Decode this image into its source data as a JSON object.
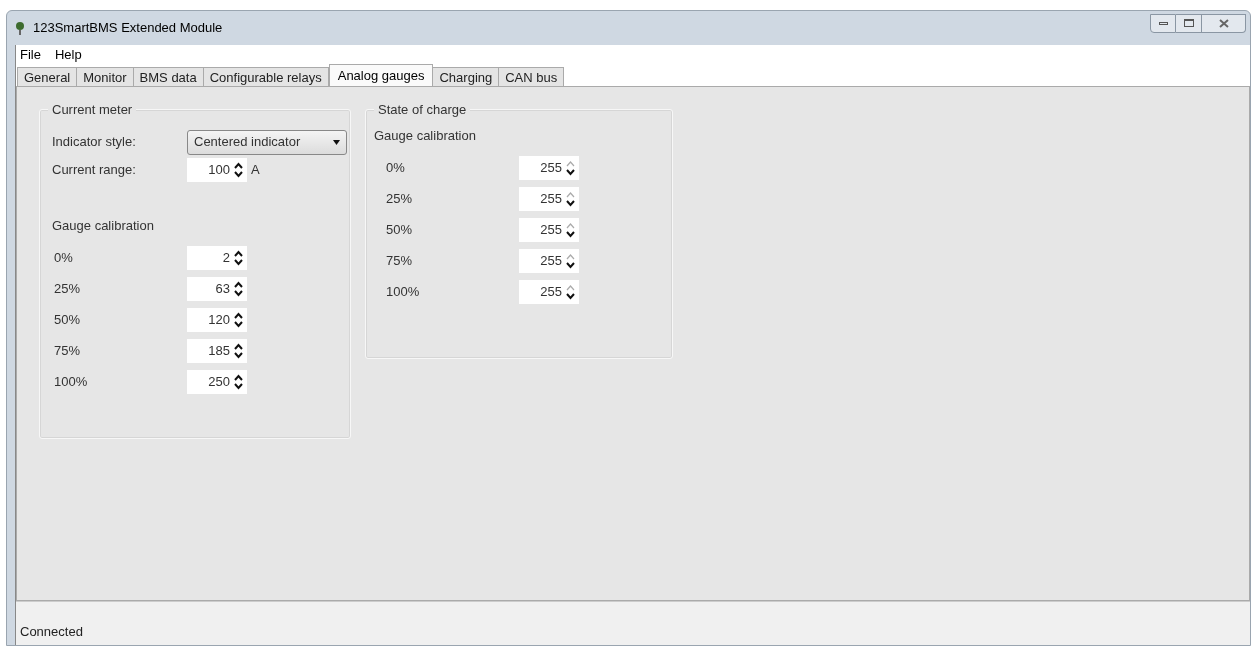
{
  "window": {
    "title": "123SmartBMS Extended Module"
  },
  "menu": [
    "File",
    "Help"
  ],
  "tabs": [
    {
      "label": "General",
      "selected": false
    },
    {
      "label": "Monitor",
      "selected": false
    },
    {
      "label": "BMS data",
      "selected": false
    },
    {
      "label": "Configurable relays",
      "selected": false
    },
    {
      "label": "Analog gauges",
      "selected": true
    },
    {
      "label": "Charging",
      "selected": false
    },
    {
      "label": "CAN bus",
      "selected": false
    }
  ],
  "current_meter": {
    "title": "Current meter",
    "indicator_style": {
      "label": "Indicator style:",
      "value": "Centered indicator"
    },
    "current_range": {
      "label": "Current range:",
      "value": "100",
      "unit": "A",
      "up_enabled": true
    },
    "calibration_title": "Gauge calibration",
    "calibration": [
      {
        "label": "0%",
        "value": "2",
        "up_enabled": true
      },
      {
        "label": "25%",
        "value": "63",
        "up_enabled": true
      },
      {
        "label": "50%",
        "value": "120",
        "up_enabled": true
      },
      {
        "label": "75%",
        "value": "185",
        "up_enabled": true
      },
      {
        "label": "100%",
        "value": "250",
        "up_enabled": true
      }
    ]
  },
  "state_of_charge": {
    "title": "State of charge",
    "calibration_title": "Gauge calibration",
    "calibration": [
      {
        "label": "0%",
        "value": "255",
        "up_enabled": false
      },
      {
        "label": "25%",
        "value": "255",
        "up_enabled": false
      },
      {
        "label": "50%",
        "value": "255",
        "up_enabled": false
      },
      {
        "label": "75%",
        "value": "255",
        "up_enabled": false
      },
      {
        "label": "100%",
        "value": "255",
        "up_enabled": false
      }
    ]
  },
  "status_bar": "Connected"
}
